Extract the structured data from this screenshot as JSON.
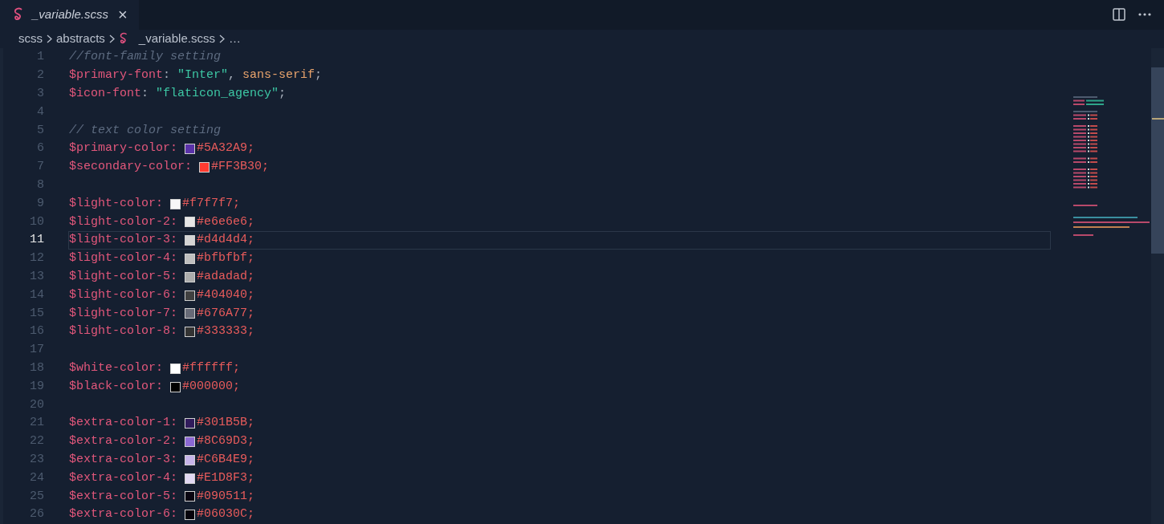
{
  "tab": {
    "title": "_variable.scss",
    "close": "×"
  },
  "breadcrumb": [
    "scss",
    "abstracts",
    "_variable.scss",
    "…"
  ],
  "lines": [
    {
      "number": "1",
      "kind": "comment",
      "text": "//font-family setting",
      "selected": false
    },
    {
      "number": "2",
      "kind": "code",
      "selected": false,
      "tokens": [
        {
          "kind": "variable",
          "text": "$primary-font"
        },
        {
          "kind": "punct",
          "text": ":"
        },
        {
          "kind": "string",
          "text": "\"Inter\""
        },
        {
          "kind": "punct",
          "text": ","
        },
        {
          "kind": "keyword",
          "text": "sans-serif"
        },
        {
          "kind": "punct",
          "text": ";"
        }
      ]
    },
    {
      "number": "3",
      "kind": "code",
      "selected": false,
      "tokens": [
        {
          "kind": "variable",
          "text": "$icon-font"
        },
        {
          "kind": "punct",
          "text": ":"
        },
        {
          "kind": "string",
          "text": "\"flaticon_agency\""
        },
        {
          "kind": "punct",
          "text": ";"
        }
      ]
    },
    {
      "number": "4",
      "kind": "blank",
      "selected": false
    },
    {
      "number": "5",
      "kind": "comment",
      "text": "// text color setting",
      "selected": false
    },
    {
      "number": "6",
      "kind": "color",
      "variable": "$primary-color:",
      "value": "#5A32A9;",
      "color": "#5a32a9",
      "selected": false
    },
    {
      "number": "7",
      "kind": "color",
      "variable": "$secondary-color:",
      "value": "#FF3B30;",
      "color": "#ff3b30",
      "selected": false
    },
    {
      "number": "8",
      "kind": "blank",
      "selected": false
    },
    {
      "number": "9",
      "kind": "color",
      "variable": "$light-color:",
      "value": "#f7f7f7;",
      "color": "#f7f7f7",
      "selected": false
    },
    {
      "number": "10",
      "kind": "color",
      "variable": "$light-color-2:",
      "value": "#e6e6e6;",
      "color": "#e6e6e6",
      "selected": false
    },
    {
      "number": "11",
      "kind": "color",
      "variable": "$light-color-3:",
      "value": "#d4d4d4;",
      "color": "#d4d4d4",
      "selected": true
    },
    {
      "number": "12",
      "kind": "color",
      "variable": "$light-color-4:",
      "value": "#bfbfbf;",
      "color": "#bfbfbf",
      "selected": false
    },
    {
      "number": "13",
      "kind": "color",
      "variable": "$light-color-5:",
      "value": "#adadad;",
      "color": "#adadad",
      "selected": false
    },
    {
      "number": "14",
      "kind": "color",
      "variable": "$light-color-6:",
      "value": "#404040;",
      "color": "#404040",
      "selected": false
    },
    {
      "number": "15",
      "kind": "color",
      "variable": "$light-color-7:",
      "value": "#676A77;",
      "color": "#676a77",
      "selected": false
    },
    {
      "number": "16",
      "kind": "color",
      "variable": "$light-color-8:",
      "value": "#333333;",
      "color": "#333333",
      "selected": false
    },
    {
      "number": "17",
      "kind": "blank",
      "selected": false
    },
    {
      "number": "18",
      "kind": "color",
      "variable": "$white-color:",
      "value": "#ffffff;",
      "color": "#ffffff",
      "selected": false
    },
    {
      "number": "19",
      "kind": "color",
      "variable": "$black-color:",
      "value": "#000000;",
      "color": "#000000",
      "selected": false
    },
    {
      "number": "20",
      "kind": "blank",
      "selected": false
    },
    {
      "number": "21",
      "kind": "color",
      "variable": "$extra-color-1:",
      "value": "#301B5B;",
      "color": "#301b5b",
      "selected": false
    },
    {
      "number": "22",
      "kind": "color",
      "variable": "$extra-color-2:",
      "value": "#8C69D3;",
      "color": "#8c69d3",
      "selected": false
    },
    {
      "number": "23",
      "kind": "color",
      "variable": "$extra-color-3:",
      "value": "#C6B4E9;",
      "color": "#c6b4e9",
      "selected": false
    },
    {
      "number": "24",
      "kind": "color",
      "variable": "$extra-color-4:",
      "value": "#E1D8F3;",
      "color": "#e1d8f3",
      "selected": false
    },
    {
      "number": "25",
      "kind": "color",
      "variable": "$extra-color-5:",
      "value": "#090511;",
      "color": "#090511",
      "selected": false
    },
    {
      "number": "26",
      "kind": "color",
      "variable": "$extra-color-6:",
      "value": "#06030C;",
      "color": "#06030c",
      "selected": false
    }
  ]
}
